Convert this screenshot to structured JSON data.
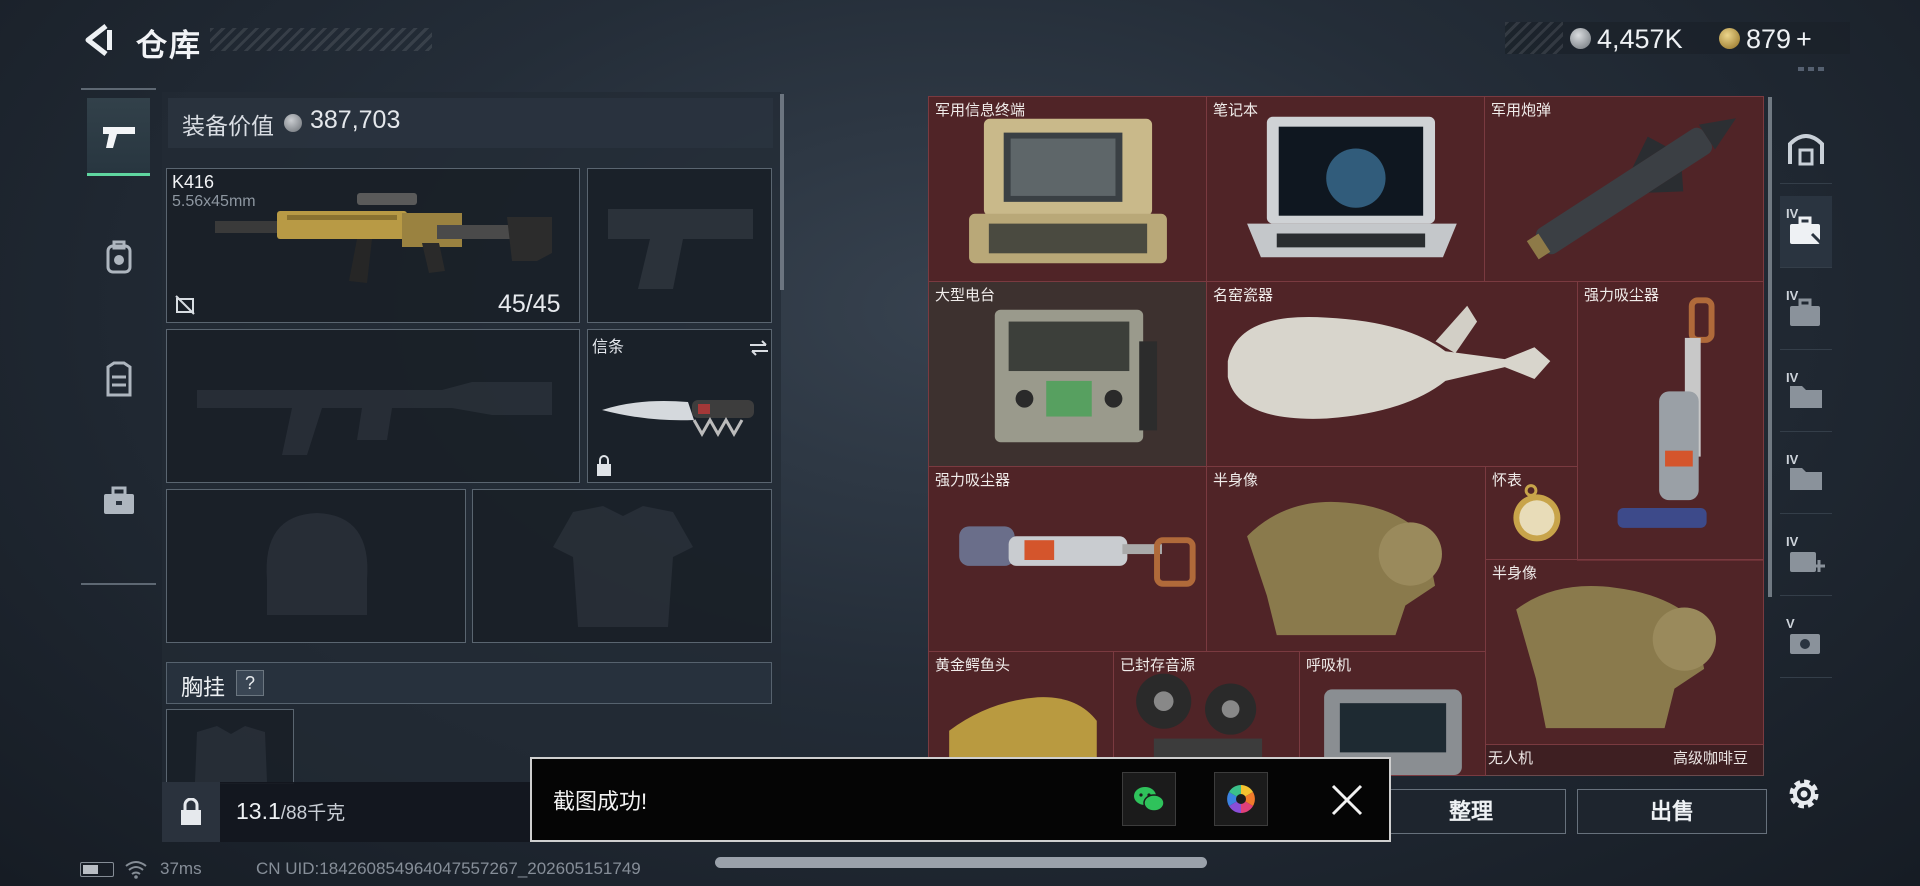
{
  "header": {
    "title": "仓库",
    "currencies": [
      {
        "icon": "silver-coin-icon",
        "value": "4,457K",
        "color": "#9ea3a8"
      },
      {
        "icon": "gold-coin-icon",
        "value": "879",
        "plus": "+",
        "color": "#c9a44a"
      }
    ]
  },
  "left_nav": [
    {
      "icon": "pistol-icon",
      "active": true
    },
    {
      "icon": "backpack-icon",
      "active": false
    },
    {
      "icon": "vest-icon",
      "active": false
    },
    {
      "icon": "briefcase-icon",
      "active": false
    }
  ],
  "loadout": {
    "equip_value_label": "装备价值",
    "equip_value": "387,703",
    "primary_weapon": {
      "name": "K416",
      "caliber": "5.56x45mm",
      "ammo": "45/45"
    },
    "melee_label": "信条",
    "chest_rig_label": "胸挂",
    "chest_rig_help": "?",
    "weight_value": "13.1",
    "weight_limit": "/88千克"
  },
  "storage": {
    "items": [
      {
        "label": "军用信息终端",
        "icon": "military-terminal-icon"
      },
      {
        "label": "笔记本",
        "icon": "laptop-icon"
      },
      {
        "label": "军用炮弹",
        "icon": "artillery-shell-icon"
      },
      {
        "label": "大型电台",
        "icon": "large-radio-icon"
      },
      {
        "label": "名窑瓷器",
        "icon": "porcelain-vase-icon"
      },
      {
        "label": "强力吸尘器",
        "icon": "vacuum-cleaner-icon"
      },
      {
        "label": "强力吸尘器",
        "icon": "vacuum-cleaner-icon"
      },
      {
        "label": "半身像",
        "icon": "bust-icon"
      },
      {
        "label": "怀表",
        "icon": "pocket-watch-icon"
      },
      {
        "label": "半身像",
        "icon": "bust-icon"
      },
      {
        "label": "黄金鳄鱼头",
        "icon": "gold-crocodile-head-icon"
      },
      {
        "label": "已封存音源",
        "icon": "reel-recorder-icon"
      },
      {
        "label": "呼吸机",
        "icon": "ventilator-icon"
      },
      {
        "label": "无人机",
        "icon": "drone-icon"
      },
      {
        "label": "高级咖啡豆",
        "icon": "coffee-beans-icon"
      }
    ],
    "colors": {
      "cell": "#5e282c",
      "cell_border": "#7a3a40"
    }
  },
  "right_tabs": [
    {
      "icon": "storage-arch-icon",
      "tier": ""
    },
    {
      "icon": "case-icon",
      "tier": "IV",
      "active": true
    },
    {
      "icon": "case-icon",
      "tier": "IV"
    },
    {
      "icon": "folder-icon",
      "tier": "IV"
    },
    {
      "icon": "folder-icon",
      "tier": "IV"
    },
    {
      "icon": "add-case-icon",
      "tier": "IV"
    },
    {
      "icon": "case-icon",
      "tier": "V"
    }
  ],
  "actions": {
    "sort": "整理",
    "sell": "出售"
  },
  "toast": {
    "message": "截图成功!",
    "share_wechat": "wechat-icon",
    "share_photos": "photos-icon"
  },
  "status": {
    "ping": "37ms",
    "uid": "CN UID:184260854964047557267_202605151749"
  },
  "accent": "#5fd6a0"
}
